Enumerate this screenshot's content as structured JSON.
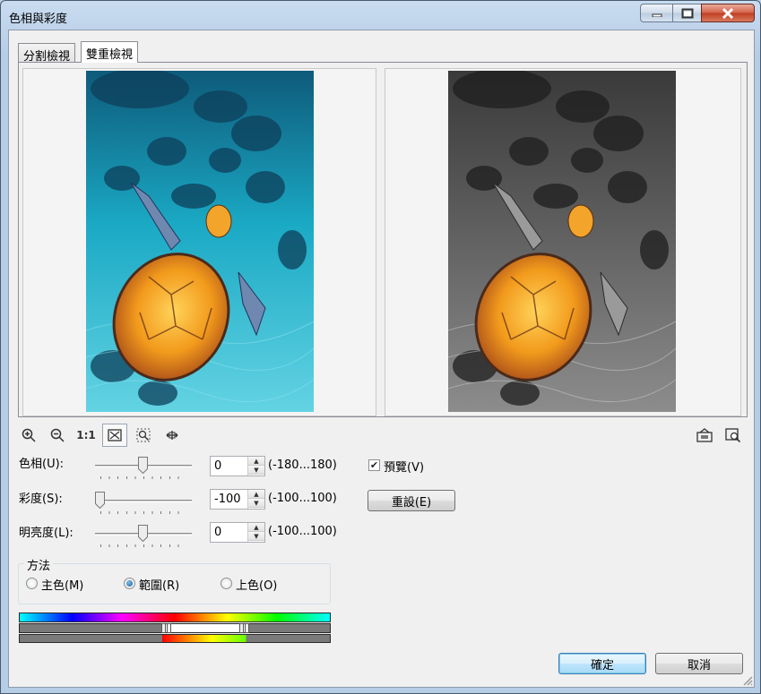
{
  "window": {
    "title": "色相與彩度"
  },
  "tabs": [
    {
      "label": "分割檢視"
    },
    {
      "label": "雙重檢視",
      "active": true
    }
  ],
  "toolbar": {
    "zoom_in": "zoom-in-icon",
    "zoom_out": "zoom-out-icon",
    "actual_size": "1:1",
    "fit": "fit-window-icon",
    "zoom_to_point": "zoom-area-icon",
    "pan": "pan-icon",
    "preview_mode": "preview-mode-icon",
    "preview_fullscreen": "preview-fullscreen-icon"
  },
  "adjustments": [
    {
      "label": "色相(U):",
      "value": "0",
      "range": "(-180...180)",
      "slider_fraction": 0.5
    },
    {
      "label": "彩度(S):",
      "value": "-100",
      "range": "(-100...100)",
      "slider_fraction": 0.0
    },
    {
      "label": "明亮度(L):",
      "value": "0",
      "range": "(-100...100)",
      "slider_fraction": 0.5
    }
  ],
  "preview": {
    "label": "預覽(V)",
    "checked": true
  },
  "reset_label": "重設(E)",
  "method": {
    "title": "方法",
    "options": [
      {
        "label": "主色(M)",
        "selected": false
      },
      {
        "label": "範圍(R)",
        "selected": true
      },
      {
        "label": "上色(O)",
        "selected": false
      }
    ]
  },
  "footer": {
    "ok_label": "確定",
    "cancel_label": "取消"
  },
  "colors": {
    "accent": "#1f5c97",
    "title_bg": "#b9d1ea",
    "close": "#c03d20"
  }
}
